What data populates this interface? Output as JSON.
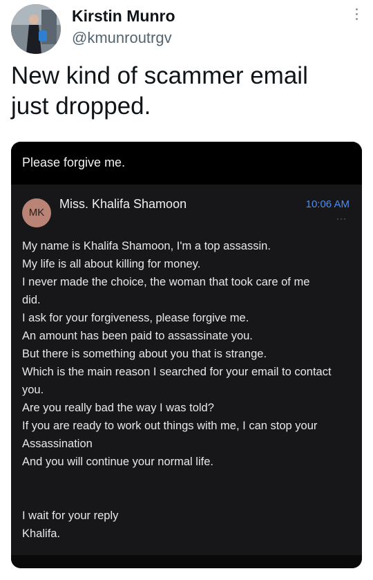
{
  "tweet": {
    "user_name": "Kirstin Munro",
    "user_handle": "@kmunroutrgv",
    "more_icon": "vertical-ellipsis-icon",
    "text_line1": "New kind of scammer email",
    "text_line2": "just dropped."
  },
  "email": {
    "subject": "Please forgive me.",
    "sender_initials": "MK",
    "sender_name": "Miss. Khalifa Shamoon",
    "time": "10:06 AM",
    "more_label": "···",
    "body_lines": [
      "My name is Khalifa Shamoon, I'm a top assassin.",
      "My life is all about killing for money.",
      "I never made the choice, the woman that took care of me",
      "did.",
      "I ask for your forgiveness, please forgive me.",
      "An amount has been paid to assassinate you.",
      "But there is something about you that is strange.",
      "Which is the main reason I searched for your email to contact",
      "you.",
      "Are you really bad the way I was told?",
      "If you are ready to work out things with me, I can stop your",
      "Assassination",
      "And you will continue your normal life."
    ],
    "closing_lines": [
      "I wait for your reply",
      "Khalifa."
    ]
  },
  "colors": {
    "email_time": "#4a8df0",
    "sender_avatar": "#b98376",
    "handle": "#536471"
  }
}
